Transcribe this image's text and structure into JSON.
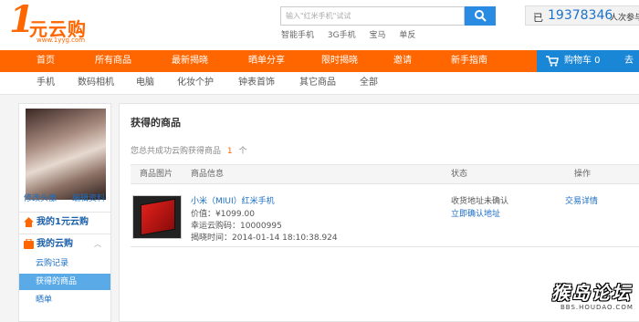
{
  "header": {
    "logo_mark": "1",
    "logo_name": "元云购",
    "logo_url": "www.1yyg.com",
    "search_placeholder": "输入\"红米手机\"试试",
    "hotwords": [
      "智能手机",
      "3G手机",
      "宝马",
      "单反"
    ],
    "counter_label": "已",
    "counter_value": "19378346",
    "counter_tail": "人次参与"
  },
  "nav": {
    "items": [
      "首页",
      "所有商品",
      "最新揭晓",
      "晒单分享",
      "限时揭晓",
      "邀请",
      "新手指南"
    ],
    "cart_label": "购物车 0",
    "cart_next": "去"
  },
  "subnav": {
    "items": [
      "手机",
      "数码相机",
      "电脑",
      "化妆个护",
      "钟表首饰",
      "其它商品",
      "全部"
    ]
  },
  "sidebar": {
    "edit_avatar": "修改头像",
    "edit_profile": "编辑资料",
    "section1": "我的1元云购",
    "section2": "我的云购",
    "items": [
      "云购记录",
      "获得的商品",
      "晒单"
    ]
  },
  "main": {
    "title": "获得的商品",
    "summary_prefix": "您总共成功云购获得商品",
    "summary_count": "1",
    "summary_suffix": "个",
    "columns": [
      "商品图片",
      "商品信息",
      "状态",
      "操作"
    ],
    "product": {
      "name": "小米（MIUI）红米手机",
      "price": "价值：¥1099.00",
      "code": "幸运云购码：10000995",
      "time": "揭晓时间：2014-01-14 18:10:38.924",
      "status": "收货地址未确认",
      "confirm": "立即确认地址",
      "op": "交易详情"
    }
  },
  "watermark": {
    "text": "猴岛论坛",
    "url": "BBS.HOUDAO.COM"
  }
}
